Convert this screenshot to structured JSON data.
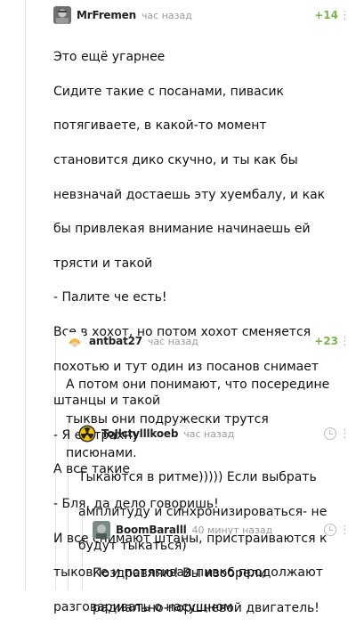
{
  "comments": [
    {
      "author": "MrFremen",
      "time": "час назад",
      "rating": "+14",
      "more": "⋮",
      "lines": [
        "Это ещё угарнее",
        "Сидите такие с посанами, пивасик",
        "потягиваете, в какой-то момент",
        "становится дико скучно, и ты как бы",
        "невзначай достаешь эту хуембалу, и как",
        "бы привлекая внимание начинаешь ей",
        "трясти и такой",
        "- Палите че есть!",
        "Все в хохот, но потом хохот сменяется",
        "похотью и тут один из посанов снимает",
        "штанцы и такой",
        "- Я её трахну",
        "А все такие",
        "- Бля, да дело говоришь!",
        "И все снимают штаны, пристраиваются к",
        "тыковке и потягивая пивко продолжают",
        "разговаривать о насущном"
      ]
    },
    {
      "author": "antbat27",
      "time": "час назад",
      "rating": "+23",
      "more": "⋮",
      "lines": [
        "А потом они понимают, что посередине",
        "тыквы они подружески трутся",
        "писюнами."
      ]
    },
    {
      "author": "ToJlctylllkoeb",
      "time": "час назад",
      "more": "⋮",
      "lines": [
        "Тыкаются в ритме))))) Если выбрать",
        "амплитуду и синхронизироваться- не",
        "будут тыкаться)"
      ]
    },
    {
      "author": "BoomBaralll",
      "time": "40 минут назад",
      "more": "⋮",
      "lines": [
        "Поздравляю! Вы изобрели",
        "радиально-поршневой двигатель!"
      ]
    }
  ]
}
